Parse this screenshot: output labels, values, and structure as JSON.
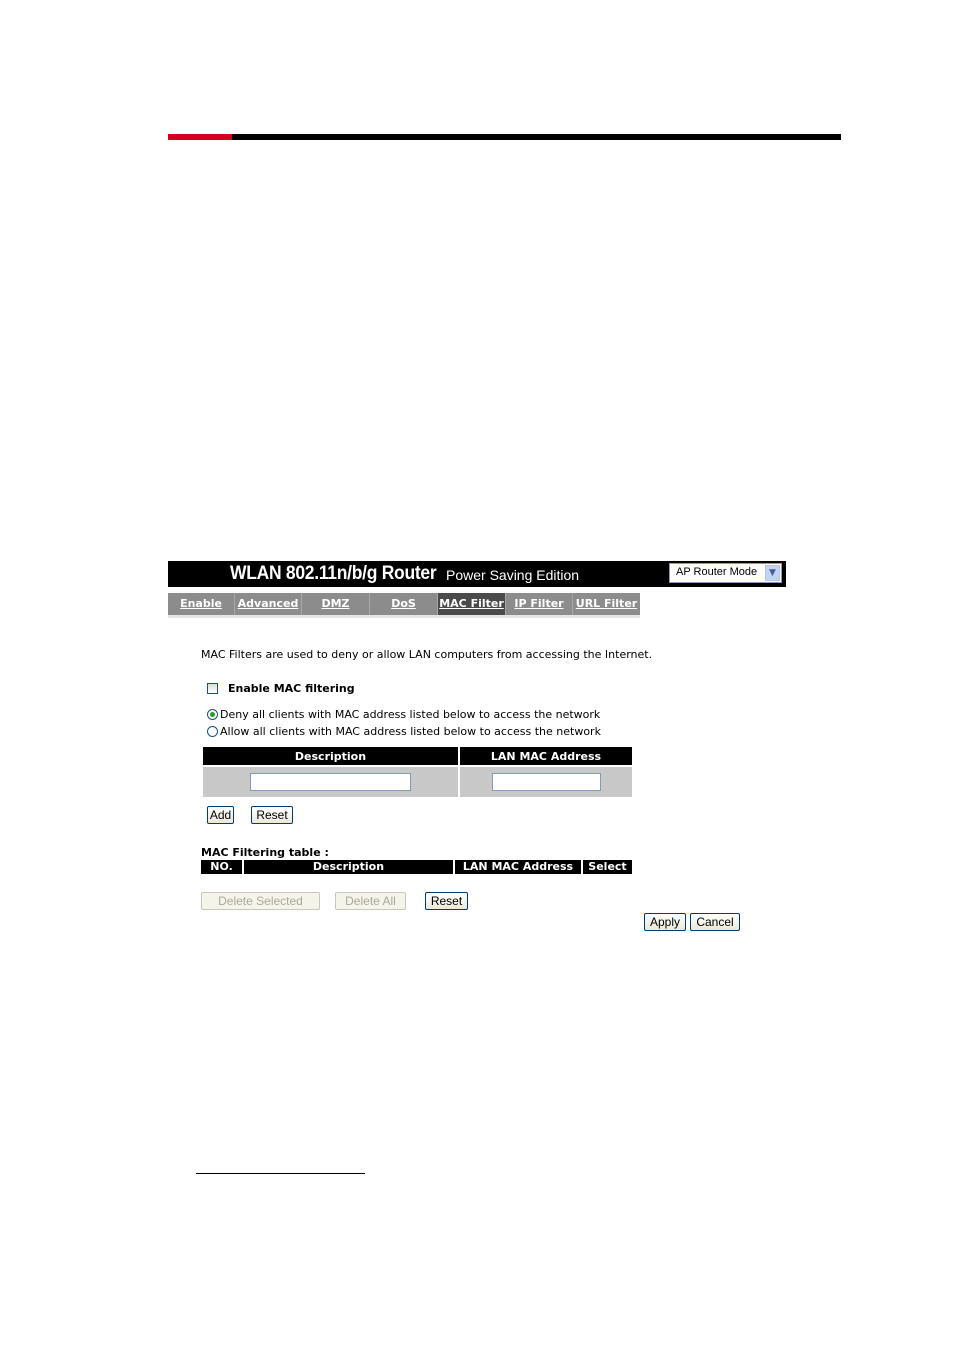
{
  "header": {
    "title_main": "WLAN 802.11n/b/g Router",
    "title_sub": "Power Saving Edition",
    "mode_select": {
      "value": "AP Router Mode",
      "icon": "chevron-down-icon"
    }
  },
  "tabs": [
    {
      "label": "Enable",
      "active": false
    },
    {
      "label": "Advanced",
      "active": false
    },
    {
      "label": "DMZ",
      "active": false
    },
    {
      "label": "DoS",
      "active": false
    },
    {
      "label": "MAC Filter",
      "active": true
    },
    {
      "label": "IP Filter",
      "active": false
    },
    {
      "label": "URL Filter",
      "active": false
    }
  ],
  "intro": "MAC Filters are used to deny or allow LAN computers from accessing the Internet.",
  "enable_mac_filtering": {
    "label": "Enable MAC filtering",
    "checked": false
  },
  "policy": {
    "deny": {
      "label": "Deny all clients with MAC address listed below to access the network",
      "checked": true
    },
    "allow": {
      "label": "Allow all clients with MAC address listed below to access the network",
      "checked": false
    }
  },
  "entry_form": {
    "headers": [
      "Description",
      "LAN MAC Address"
    ],
    "description_value": "",
    "mac_value": "",
    "add_label": "Add",
    "reset_label": "Reset"
  },
  "filtering_table": {
    "title": "MAC Filtering table :",
    "headers": [
      "NO.",
      "Description",
      "LAN MAC Address",
      "Select"
    ],
    "rows": []
  },
  "table_actions": {
    "delete_selected_label": "Delete Selected",
    "delete_all_label": "Delete All",
    "reset_label": "Reset"
  },
  "footer_actions": {
    "apply_label": "Apply",
    "cancel_label": "Cancel"
  },
  "colors": {
    "accent_red": "#d2001e",
    "tab_bar": "#8c8c8c",
    "tab_active": "#4a4a4a"
  }
}
